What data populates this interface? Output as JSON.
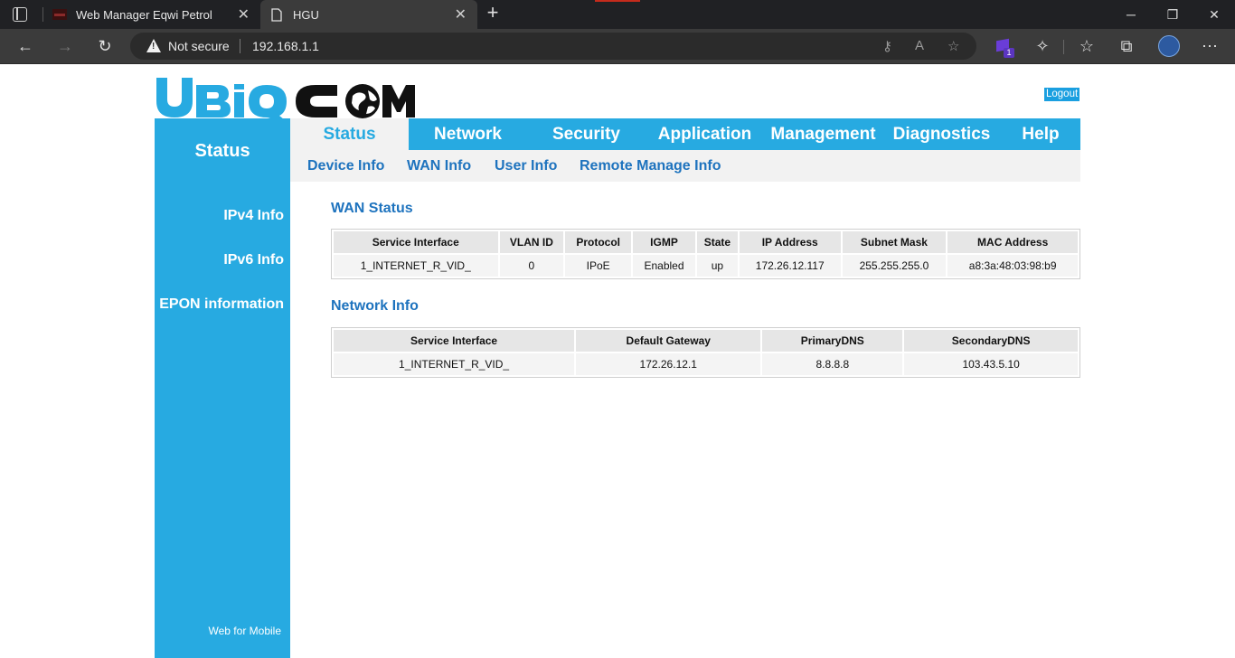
{
  "browser": {
    "tabs": [
      {
        "title": "Web Manager Eqwi Petrol",
        "active": false
      },
      {
        "title": "HGU",
        "active": true
      }
    ],
    "security_label": "Not secure",
    "url": "192.168.1.1",
    "extension_badge": "1"
  },
  "header": {
    "logo_text": "UBIQCOM",
    "logout_label": "Logout"
  },
  "sidebar": {
    "title": "Status",
    "items": [
      {
        "label": "IPv4 Info"
      },
      {
        "label": "IPv6 Info"
      },
      {
        "label": "EPON information"
      }
    ],
    "footer": "Web for Mobile"
  },
  "nav": {
    "items": [
      {
        "label": "Status",
        "active": true
      },
      {
        "label": "Network"
      },
      {
        "label": "Security"
      },
      {
        "label": "Application"
      },
      {
        "label": "Management"
      },
      {
        "label": "Diagnostics"
      },
      {
        "label": "Help"
      }
    ]
  },
  "subnav": {
    "items": [
      {
        "label": "Device Info"
      },
      {
        "label": "WAN Info"
      },
      {
        "label": "User Info"
      },
      {
        "label": "Remote Manage Info"
      }
    ]
  },
  "wan_status": {
    "title": "WAN Status",
    "headers": [
      "Service Interface",
      "VLAN ID",
      "Protocol",
      "IGMP",
      "State",
      "IP Address",
      "Subnet Mask",
      "MAC Address"
    ],
    "rows": [
      [
        "1_INTERNET_R_VID_",
        "0",
        "IPoE",
        "Enabled",
        "up",
        "172.26.12.117",
        "255.255.255.0",
        "a8:3a:48:03:98:b9"
      ]
    ]
  },
  "network_info": {
    "title": "Network Info",
    "headers": [
      "Service Interface",
      "Default Gateway",
      "PrimaryDNS",
      "SecondaryDNS"
    ],
    "rows": [
      [
        "1_INTERNET_R_VID_",
        "172.26.12.1",
        "8.8.8.8",
        "103.43.5.10"
      ]
    ]
  },
  "colors": {
    "brand_blue": "#27aae1",
    "link_blue": "#1e73be",
    "browser_dark": "#202124"
  }
}
